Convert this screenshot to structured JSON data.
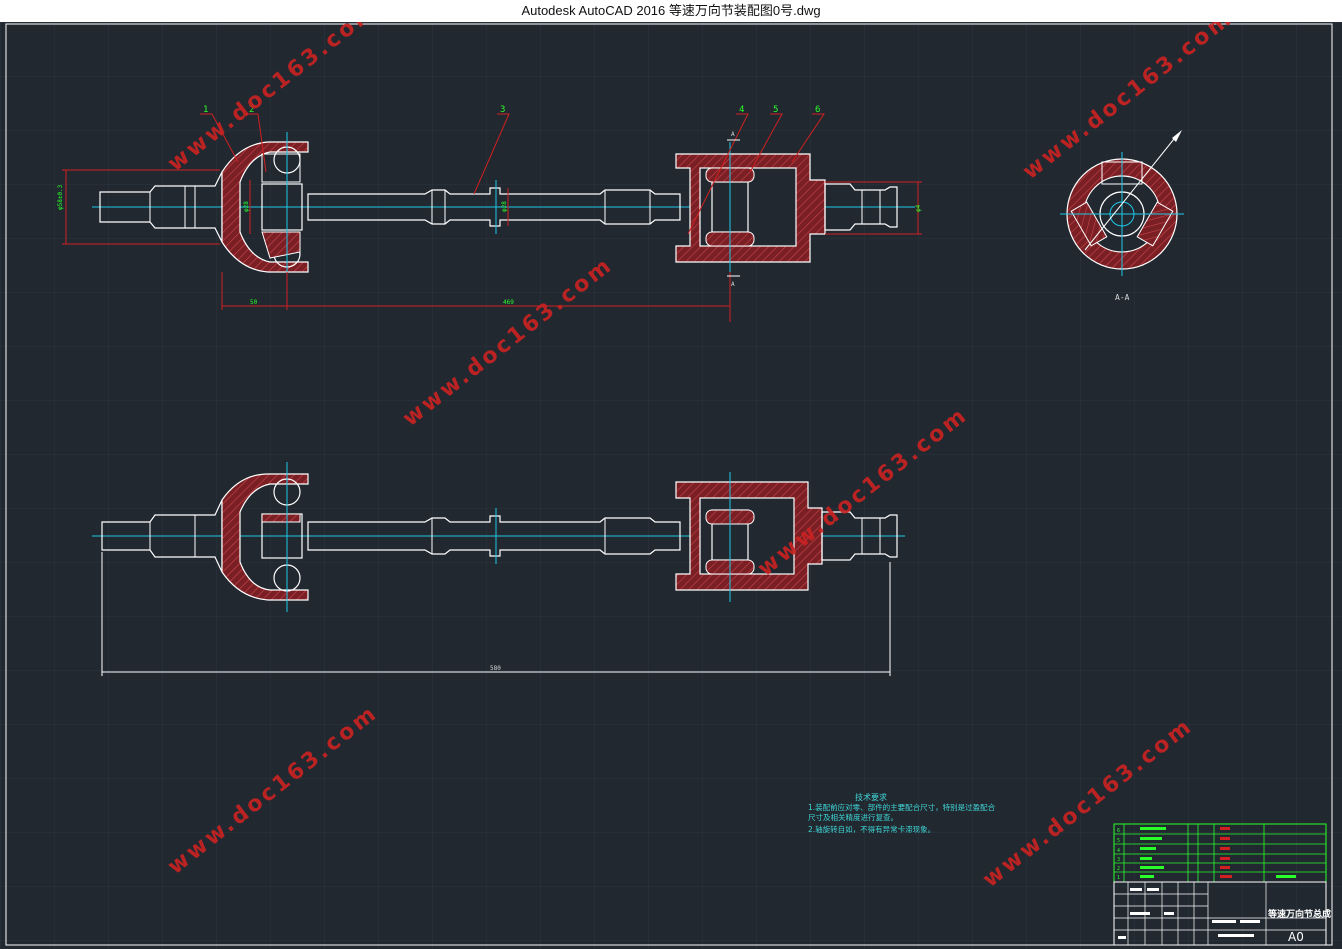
{
  "window": {
    "title": "Autodesk AutoCAD 2016     等速万向节装配图0号.dwg"
  },
  "drawing": {
    "balloons": [
      "1",
      "2",
      "3",
      "4",
      "5",
      "6"
    ],
    "dimensions": {
      "left_dia": "φ58±0.3",
      "left_bore": "φ28",
      "mid_dia": "φ28",
      "right_dia": "φ4",
      "len_50": "50",
      "len_469": "469",
      "overall": "580"
    },
    "section_marks": [
      "A",
      "A"
    ],
    "section_title": "A-A",
    "tech_req": {
      "title": "技术要求",
      "line1": "1.装配前应对零、部件的主要配合尺寸，特别是过盈配合",
      "line2": "  尺寸及相关精度进行复查。",
      "line3": "2.轴旋转自如，不得有异常卡滞现象。"
    },
    "watermark": "www.doc163.com",
    "title_block": {
      "name": "等速万向节总成",
      "sheet": "A0"
    },
    "bom_rows": [
      "6",
      "5",
      "4",
      "3",
      "2",
      "1"
    ],
    "colors": {
      "background": "#212830",
      "outline": "#ffffff",
      "center": "#1ec8e8",
      "hatch": "#c03030",
      "leader": "#d02020",
      "dimension": "#2aff2a"
    }
  }
}
